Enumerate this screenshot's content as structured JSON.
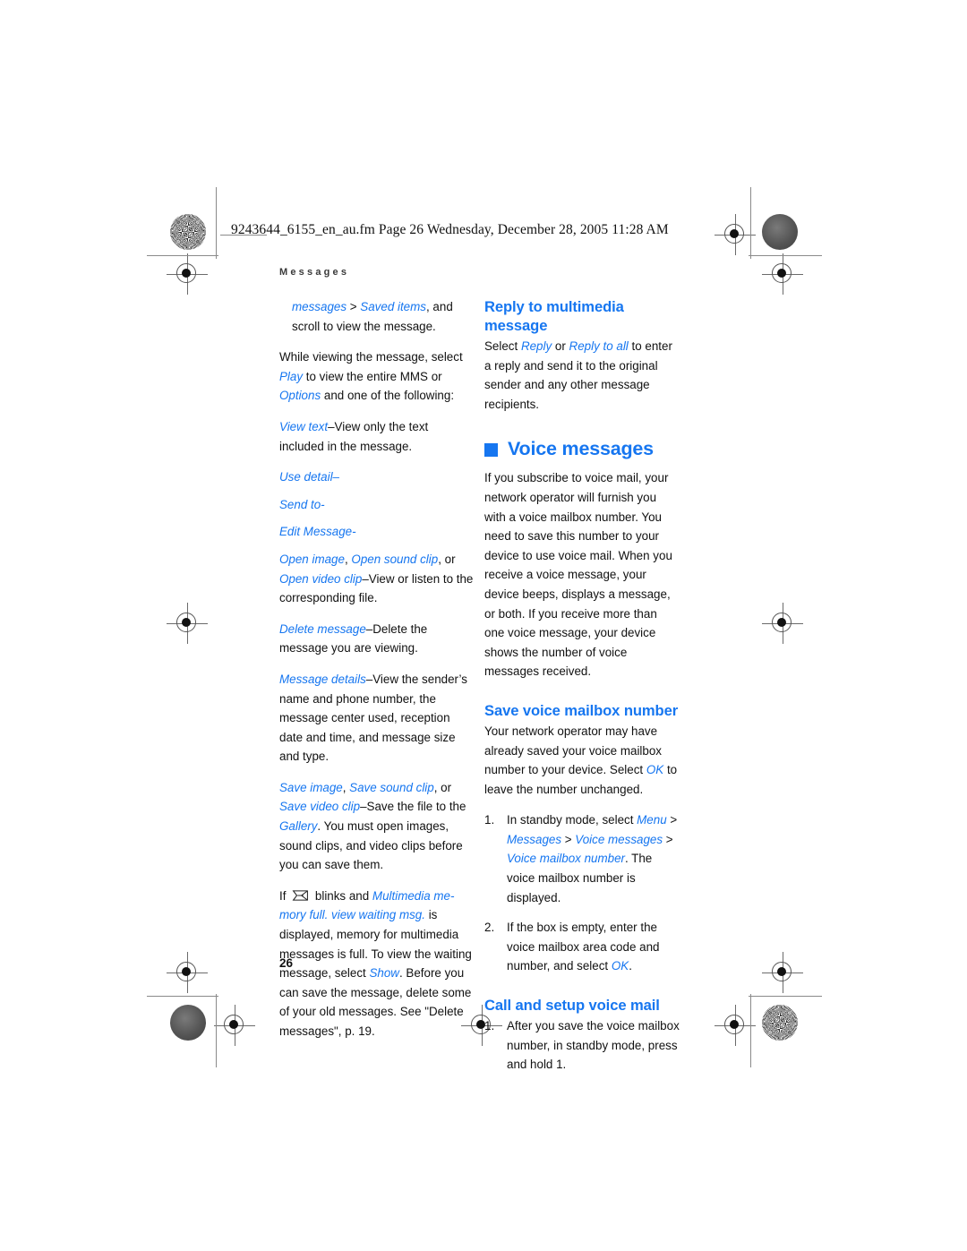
{
  "document": {
    "file_line": "9243644_6155_en_au.fm   Page 26   Wednesday, December 28, 2005   11:28 AM",
    "running_head": "Messages",
    "page_number": "26",
    "accent_color": "#1676f0",
    "text_color": "#111111"
  },
  "left_column": {
    "para_continued": {
      "blue_1": "messages",
      "sep_1": " > ",
      "blue_2": "Saved items",
      "rest": ", and scroll to view the message."
    },
    "para_while_viewing": {
      "t1": "While viewing the message, select ",
      "blue_1": "Play",
      "t2": " to view the entire MMS or ",
      "blue_2": "Options",
      "t3": " and one of the following:"
    },
    "item_view_text": {
      "blue": "View text",
      "rest": "–View only the text included in the message."
    },
    "item_use_detail": "Use detail–",
    "item_send_to": "Send to-",
    "item_edit_message": "Edit Message-",
    "item_open": {
      "blue_1": "Open image",
      "sep_1": ", ",
      "blue_2": "Open sound clip",
      "sep_2": ", or ",
      "blue_3": "Open video clip",
      "rest": "–View or listen to the corresponding file."
    },
    "item_delete_message": {
      "blue": "Delete message",
      "rest": "–Delete the message you are viewing."
    },
    "item_message_details": {
      "blue": "Message details",
      "rest": "–View the sender’s name and phone number, the message center used, reception date and time, and message size and type."
    },
    "item_save": {
      "blue_1": "Save image",
      "sep_1": ", ",
      "blue_2": "Save sound clip",
      "sep_2": ", or ",
      "blue_3": "Save video clip",
      "t1": "–Save the file to the ",
      "blue_4": "Gallery",
      "t2": ". You must open images, sound clips, and video clips before you can save them."
    },
    "para_blinks": {
      "t1": "If ",
      "icon": "envelope-icon",
      "t2": " blinks and ",
      "blue_1": "Multimedia me-mory full. view waiting msg.",
      "t3": " is displayed, memory for multimedia messages is full. To view the waiting message, select ",
      "blue_2": "Show",
      "t4": ". Before you can save the message, delete some of your old messages. See \"Delete messages\", p. 19."
    }
  },
  "right_column": {
    "heading_reply": "Reply to multimedia message",
    "para_reply": {
      "t1": "Select ",
      "blue_1": "Reply",
      "t2": " or ",
      "blue_2": "Reply to all",
      "t3": " to enter a reply and send it to the original sender and any other message recipients."
    },
    "heading_voice_messages": "Voice messages",
    "para_voice_intro": "If you subscribe to voice mail, your network operator will furnish you with a voice mailbox number. You need to save this number to your device to use voice mail. When you receive a voice message, your device beeps, displays a message, or both. If you receive more than one voice message, your device shows the number of voice messages received.",
    "heading_save_mailbox": "Save voice mailbox number",
    "para_save_mailbox": {
      "t1": "Your network operator may have already saved your voice mailbox number to your device. Select ",
      "blue_1": "OK",
      "t2": " to leave the number unchanged."
    },
    "steps_save": [
      {
        "num": "1.",
        "t1": "In standby mode, select ",
        "blue_1": "Menu",
        "sep_1": " > ",
        "blue_2": "Messages",
        "sep_2": " > ",
        "blue_3": "Voice messages",
        "sep_3": " > ",
        "blue_4": "Voice mailbox number",
        "t2": ". The voice mailbox number is displayed."
      },
      {
        "num": "2.",
        "t1": "If the box is empty, enter the voice mailbox area code and number, and select ",
        "blue_1": "OK",
        "t2": "."
      }
    ],
    "heading_call_setup": "Call and setup voice mail",
    "steps_call": [
      {
        "num": "1.",
        "t1": "After you save the voice mailbox number, in standby mode, press and hold 1."
      }
    ]
  }
}
